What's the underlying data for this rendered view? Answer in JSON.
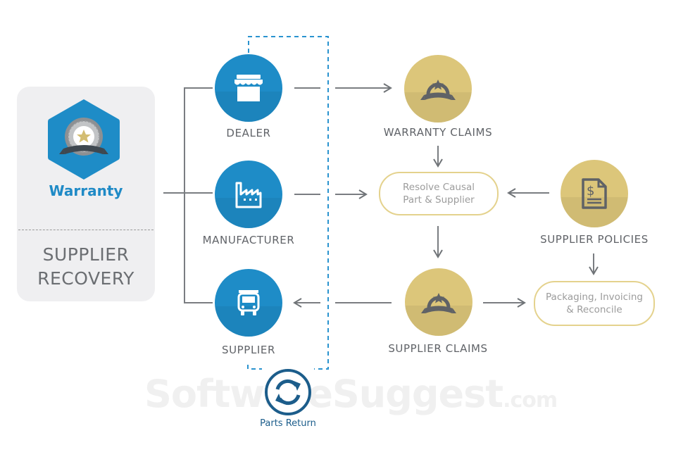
{
  "diagram": {
    "left_card": {
      "badge_label": "Warranty",
      "title_line1": "SUPPLIER",
      "title_line2": "RECOVERY"
    },
    "entities": [
      {
        "id": "dealer",
        "label": "DEALER",
        "icon": "store-icon"
      },
      {
        "id": "manufacturer",
        "label": "MANUFACTURER",
        "icon": "factory-icon"
      },
      {
        "id": "supplier",
        "label": "SUPPLIER",
        "icon": "truck-icon"
      }
    ],
    "process_nodes": [
      {
        "id": "warranty-claims",
        "label": "WARRANTY CLAIMS",
        "icon": "award-badge-icon"
      },
      {
        "id": "supplier-policies",
        "label": "SUPPLIER POLICIES",
        "icon": "invoice-document-icon"
      },
      {
        "id": "supplier-claims",
        "label": "SUPPLIER CLAIMS",
        "icon": "award-badge-icon"
      }
    ],
    "steps": [
      {
        "id": "resolve",
        "line1": "Resolve Causal",
        "line2": "Part & Supplier"
      },
      {
        "id": "packaging",
        "line1": "Packaging, Invoicing",
        "line2": "& Reconcile"
      }
    ],
    "parts_return": {
      "label": "Parts Return",
      "icon": "refresh-cycle-icon"
    },
    "watermark": {
      "main": "SoftwareSuggest",
      "suffix": ".com"
    },
    "colors": {
      "entity_blue": "#1e8cc7",
      "process_gold": "#dcc67a",
      "pill_border": "#e4d28d",
      "connector_gray": "#6f7377",
      "dashed_blue": "#2a93cf",
      "parts_return_navy": "#1c5d8b"
    }
  }
}
